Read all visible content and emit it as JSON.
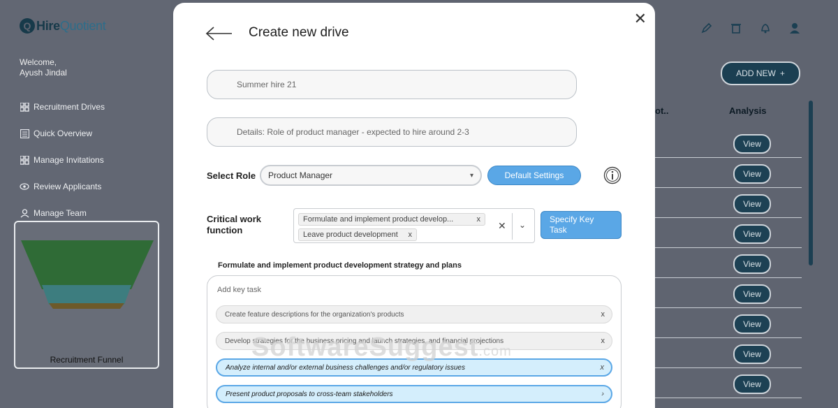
{
  "app": {
    "logo_mark": "Q",
    "logo_brand": "Hire",
    "logo_brand_2": "Quotient"
  },
  "sidebar": {
    "welcome": "Welcome,",
    "user_name": "Ayush Jindal",
    "items": [
      {
        "label": "Recruitment Drives",
        "icon": "grid-icon"
      },
      {
        "label": "Quick Overview",
        "icon": "list-icon"
      },
      {
        "label": "Manage Invitations",
        "icon": "grid-icon"
      },
      {
        "label": "Review Applicants",
        "icon": "eye-icon"
      },
      {
        "label": "Manage Team",
        "icon": "person-icon"
      }
    ],
    "funnel_title": "Recruitment Funnel"
  },
  "background": {
    "add_new_label": "ADD NEW",
    "add_new_icon": "plus-icon",
    "column_partial": "ot..",
    "column_analysis": "Analysis",
    "view_label": "View",
    "view_count": 9
  },
  "modal": {
    "title": "Create new drive",
    "drive_name": "Summer hire 21",
    "details": "Details: Role of product manager - expected to hire around 2-3",
    "select_role_label": "Select Role",
    "selected_role": "Product Manager",
    "default_settings_label": "Default Settings",
    "critical_work_label": "Critical work\nfunction",
    "chips": [
      "Formulate and implement product develop...",
      "Leave product development"
    ],
    "specify_key_task_label": "Specify Key\nTask",
    "section_heading": "Formulate and implement product development strategy and plans",
    "add_key_task_placeholder": "Add key task",
    "tasks": [
      {
        "text": "Create feature descriptions for the organization's products",
        "style": "grey"
      },
      {
        "text": "Develop strategies for the business pricing and launch strategies, and financial projections",
        "style": "grey"
      },
      {
        "text": "Analyze internal and/or external business challenges and/or regulatory issues",
        "style": "blue"
      },
      {
        "text": "Present product proposals to cross-team stakeholders",
        "style": "blue"
      }
    ]
  },
  "watermark": {
    "text": "SoftwareSuggest",
    "suffix": ".com"
  }
}
